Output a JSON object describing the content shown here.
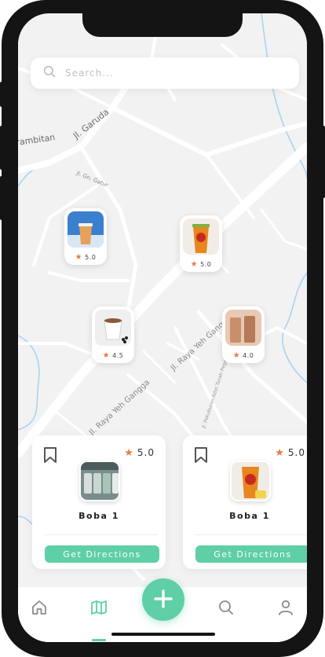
{
  "search": {
    "placeholder": "Search..."
  },
  "map_labels": {
    "road_1": "Jl. Garuda",
    "road_2": "Jl. Gn. Gatur",
    "road_3": "Jl. Raya Yeh Gangga",
    "road_4": "Jl. Raya Yeh Gangga",
    "road_5": "Jl. Pekuburan Adat Tanah Pegat Gg",
    "place_1": "rambitan"
  },
  "markers": [
    {
      "rating": "5.0"
    },
    {
      "rating": "5.0"
    },
    {
      "rating": "4.5"
    },
    {
      "rating": "4.0"
    }
  ],
  "cards": [
    {
      "name": "Boba 1",
      "rating": "5.0",
      "button_label": "Get Directions"
    },
    {
      "name": "Boba 1",
      "rating": "5.0",
      "button_label": "Get Directions"
    }
  ],
  "nav": {
    "items": [
      {
        "icon": "home-icon"
      },
      {
        "icon": "map-icon",
        "active": true
      },
      {
        "icon": "plus-icon"
      },
      {
        "icon": "search-icon"
      },
      {
        "icon": "user-icon"
      }
    ]
  },
  "colors": {
    "accent": "#5fcfa6",
    "star": "#e87a44",
    "map_bg": "#f2f2f2",
    "water": "#a9d3f2"
  }
}
